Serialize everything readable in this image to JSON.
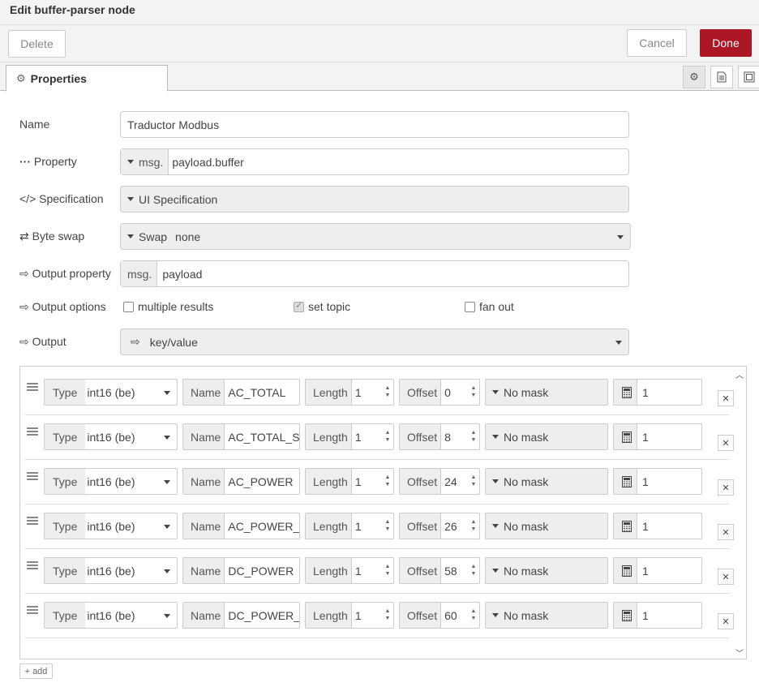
{
  "title": "Edit buffer-parser node",
  "header": {
    "delete_label": "Delete",
    "cancel_label": "Cancel",
    "done_label": "Done"
  },
  "tab": {
    "label": "Properties"
  },
  "form": {
    "name_label": "Name",
    "name_value": "Traductor Modbus",
    "property_label": "Property",
    "property_type": "msg.",
    "property_value": "payload.buffer",
    "spec_label": "Specification",
    "spec_value": "UI Specification",
    "byteswap_label": "Byte swap",
    "byteswap_prefix": "Swap",
    "byteswap_value": "none",
    "outprop_label": "Output property",
    "outprop_type": "msg.",
    "outprop_value": "payload",
    "outopts_label": "Output options",
    "opt_multiple": "multiple results",
    "opt_multiple_checked": false,
    "opt_settopic": "set topic",
    "opt_settopic_checked": true,
    "opt_fanout": "fan out",
    "opt_fanout_checked": false,
    "output_label": "Output",
    "output_value": "key/value"
  },
  "rows_labels": {
    "type": "Type",
    "name": "Name",
    "length": "Length",
    "offset": "Offset"
  },
  "rows": [
    {
      "type": "int16 (be)",
      "name": "AC_TOTAL",
      "length": "1",
      "offset": "0",
      "mask": "No mask",
      "scale": "1"
    },
    {
      "type": "int16 (be)",
      "name": "AC_TOTAL_SC",
      "length": "1",
      "offset": "8",
      "mask": "No mask",
      "scale": "1"
    },
    {
      "type": "int16 (be)",
      "name": "AC_POWER",
      "length": "1",
      "offset": "24",
      "mask": "No mask",
      "scale": "1"
    },
    {
      "type": "int16 (be)",
      "name": "AC_POWER_SC",
      "length": "1",
      "offset": "26",
      "mask": "No mask",
      "scale": "1"
    },
    {
      "type": "int16 (be)",
      "name": "DC_POWER",
      "length": "1",
      "offset": "58",
      "mask": "No mask",
      "scale": "1"
    },
    {
      "type": "int16 (be)",
      "name": "DC_POWER_SC",
      "length": "1",
      "offset": "60",
      "mask": "No mask",
      "scale": "1"
    }
  ],
  "add_label": "add",
  "colors": {
    "primary": "#ad1625"
  }
}
